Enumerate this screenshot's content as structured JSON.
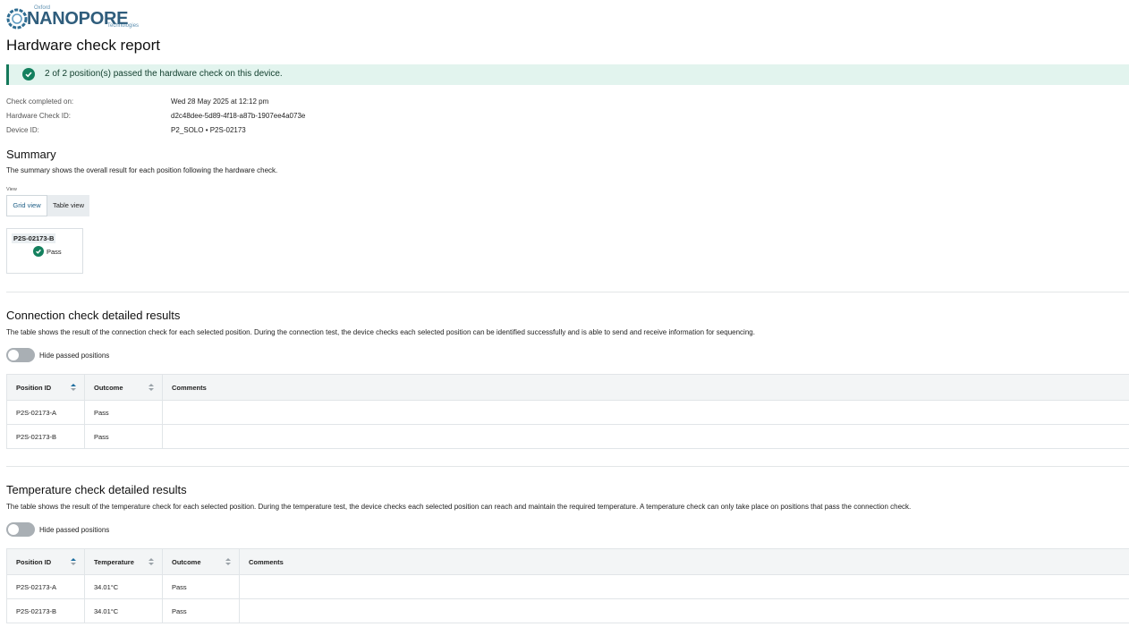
{
  "logo": {
    "top": "Oxford",
    "main": "NANOPORE",
    "sub": "Technologies"
  },
  "page_title": "Hardware check report",
  "banner": {
    "text": "2 of 2 position(s) passed the hardware check on this device.",
    "status": "success",
    "color": "#14805e"
  },
  "meta": [
    {
      "label": "Check completed on:",
      "value": "Wed 28 May 2025 at 12:12 pm"
    },
    {
      "label": "Hardware Check ID:",
      "value": "d2c48dee-5d89-4f18-a87b-1907ee4a073e"
    },
    {
      "label": "Device ID:",
      "value": "P2_SOLO • P2S-02173"
    }
  ],
  "summary": {
    "title": "Summary",
    "description": "The summary shows the overall result for each position following the hardware check.",
    "view_label": "View",
    "views": [
      "Grid view",
      "Table view"
    ],
    "selected_view": "Grid view",
    "cards": [
      {
        "position": "P2S-02173-B",
        "result": "Pass"
      }
    ]
  },
  "connection": {
    "title": "Connection check detailed results",
    "description": "The table shows the result of the connection check for each selected position. During the connection test, the device checks each selected position can be identified successfully and is able to send and receive information for sequencing.",
    "toggle_label": "Hide passed positions",
    "toggle_on": false,
    "columns": [
      "Position ID",
      "Outcome",
      "Comments"
    ],
    "rows": [
      {
        "position": "P2S-02173-A",
        "outcome": "Pass",
        "comments": ""
      },
      {
        "position": "P2S-02173-B",
        "outcome": "Pass",
        "comments": ""
      }
    ]
  },
  "temperature": {
    "title": "Temperature check detailed results",
    "description": "The table shows the result of the temperature check for each selected position. During the temperature test, the device checks each selected position can reach and maintain the required temperature. A temperature check can only take place on positions that pass the connection check.",
    "toggle_label": "Hide passed positions",
    "toggle_on": false,
    "columns": [
      "Position ID",
      "Temperature",
      "Outcome",
      "Comments"
    ],
    "rows": [
      {
        "position": "P2S-02173-A",
        "temperature": "34.01°C",
        "outcome": "Pass",
        "comments": ""
      },
      {
        "position": "P2S-02173-B",
        "temperature": "34.01°C",
        "outcome": "Pass",
        "comments": ""
      }
    ]
  }
}
